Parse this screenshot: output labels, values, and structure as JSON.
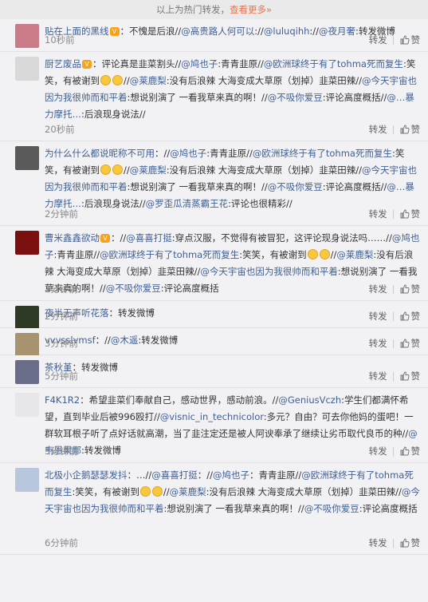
{
  "header": {
    "text": "以上为热门转发，",
    "more": "查看更多»"
  },
  "actions": {
    "repost": "转发",
    "like": "赞"
  },
  "items": [
    {
      "user": "贴在上面的黑线",
      "badge": true,
      "segments": [
        [
          "t",
          "：不愧是后浪//"
        ],
        [
          "l",
          "@高贵路人何可以"
        ],
        [
          "t",
          "://"
        ],
        [
          "l",
          "@luluqihh"
        ],
        [
          "t",
          "://"
        ],
        [
          "l",
          "@夜月奢"
        ],
        [
          "t",
          ":转发微博"
        ]
      ],
      "time": "10秒前",
      "avatar_color": "#c97b87"
    },
    {
      "user": "厨艺废品",
      "badge": true,
      "segments": [
        [
          "t",
          "：评论真是韭菜割头//"
        ],
        [
          "l",
          "@鸠也子"
        ],
        [
          "t",
          ":青青韭原//"
        ],
        [
          "l",
          "@欧洲球终于有了tohma死而复生"
        ],
        [
          "t",
          ":笑笑，有被谢到"
        ],
        [
          "e",
          ""
        ],
        [
          "e",
          ""
        ],
        [
          "t",
          "//"
        ],
        [
          "l",
          "@莱鹿梨"
        ],
        [
          "t",
          ":没有后浪辣 大海变成大草原（划掉）韭菜田辣//"
        ],
        [
          "l",
          "@今天宇宙也因为我很帅而和平着"
        ],
        [
          "t",
          ":想说别演了 一看我草来真的啊！//"
        ],
        [
          "l",
          "@不吸你爱豆"
        ],
        [
          "t",
          ":评论高度概括//"
        ],
        [
          "l",
          "@…暴力摩托…"
        ],
        [
          "t",
          ":后浪现身说法//"
        ]
      ],
      "time": "20秒前",
      "avatar_color": "#d9d9d9"
    },
    {
      "user": "为什么什么都说昵称不可用",
      "badge": false,
      "segments": [
        [
          "t",
          "：//"
        ],
        [
          "l",
          "@鸠也子"
        ],
        [
          "t",
          ":青青韭原//"
        ],
        [
          "l",
          "@欧洲球终于有了tohma死而复生"
        ],
        [
          "t",
          ":笑笑，有被谢到"
        ],
        [
          "e",
          ""
        ],
        [
          "e",
          ""
        ],
        [
          "t",
          "//"
        ],
        [
          "l",
          "@莱鹿梨"
        ],
        [
          "t",
          ":没有后浪辣 大海变成大草原（划掉）韭菜田辣//"
        ],
        [
          "l",
          "@今天宇宙也因为我很帅而和平着"
        ],
        [
          "t",
          ":想说别演了 一看我草来真的啊！//"
        ],
        [
          "l",
          "@不吸你爱豆"
        ],
        [
          "t",
          ":评论高度概括//"
        ],
        [
          "l",
          "@…暴力摩托…"
        ],
        [
          "t",
          ":后浪现身说法//"
        ],
        [
          "l",
          "@罗歪瓜清蒸霸王花"
        ],
        [
          "t",
          ":评论也很精彩//"
        ]
      ],
      "time": "2分钟前",
      "avatar_color": "#5a5a5a"
    },
    {
      "user": "曹米鑫鑫欲动",
      "badge": true,
      "segments": [
        [
          "t",
          "：//"
        ],
        [
          "l",
          "@喜喜打挺"
        ],
        [
          "t",
          ":穿点汉服，不觉得有被冒犯，这评论现身说法吗……//"
        ],
        [
          "l",
          "@鸠也子"
        ],
        [
          "t",
          ":青青韭原//"
        ],
        [
          "l",
          "@欧洲球终于有了tohma死而复生"
        ],
        [
          "t",
          ":笑笑，有被谢到"
        ],
        [
          "e",
          ""
        ],
        [
          "e",
          ""
        ],
        [
          "t",
          "//"
        ],
        [
          "l",
          "@莱鹿梨"
        ],
        [
          "t",
          ":没有后浪辣 大海变成大草原（划掉）韭菜田辣//"
        ],
        [
          "l",
          "@今天宇宙也因为我很帅而和平着"
        ],
        [
          "t",
          ":想说别演了 一看我草来真的啊！//"
        ],
        [
          "l",
          "@不吸你爱豆"
        ],
        [
          "t",
          ":评论高度概括"
        ]
      ],
      "time": "2分钟前",
      "avatar_color": "#7a1010"
    },
    {
      "user": "夜半无声听花落",
      "badge": false,
      "segments": [
        [
          "t",
          "：转发微博"
        ]
      ],
      "time": "2分钟前",
      "avatar_color": "#2e3a24"
    },
    {
      "user": "vvvsslvmsf",
      "badge": false,
      "segments": [
        [
          "t",
          "：//"
        ],
        [
          "l",
          "@木遥"
        ],
        [
          "t",
          ":转发微博"
        ]
      ],
      "time": "3分钟前",
      "avatar_color": "#a89370"
    },
    {
      "user": "茶秋堇",
      "badge": false,
      "segments": [
        [
          "t",
          "：转发微博"
        ]
      ],
      "time": "5分钟前",
      "avatar_color": "#6a6d8a"
    },
    {
      "user": "F4K1R2",
      "badge": false,
      "segments": [
        [
          "t",
          "：希望韭菜们奉献自己，感动世界，感动前浪。//"
        ],
        [
          "l",
          "@GeniusVczh"
        ],
        [
          "t",
          ":学生们都满怀希望，直到毕业后被996殴打//"
        ],
        [
          "l",
          "@visnic_in_technicolor"
        ],
        [
          "t",
          ":多元？自由？可去你他妈的蛋吧！一群软耳根子听了点好话就高潮，当了韭注定还是被人阿谀奉承了继续让劣币取代良币的种//"
        ],
        [
          "l",
          "@韦恩果鄙"
        ],
        [
          "t",
          ":转发微博"
        ]
      ],
      "time": "5分钟前",
      "avatar_color": "#e7e7ea"
    },
    {
      "user": "北极小企鹅瑟瑟发抖",
      "badge": false,
      "segments": [
        [
          "t",
          "：…//"
        ],
        [
          "l",
          "@喜喜打挺"
        ],
        [
          "t",
          "：//"
        ],
        [
          "l",
          "@鸠也子"
        ],
        [
          "t",
          "：青青韭原//"
        ],
        [
          "l",
          "@欧洲球终于有了tohma死而复生"
        ],
        [
          "t",
          ":笑笑，有被谢到"
        ],
        [
          "e",
          ""
        ],
        [
          "e",
          ""
        ],
        [
          "t",
          "//"
        ],
        [
          "l",
          "@莱鹿梨"
        ],
        [
          "t",
          ":没有后浪辣 大海变成大草原（划掉）韭菜田辣//"
        ],
        [
          "l",
          "@今天宇宙也因为我很帅而和平着"
        ],
        [
          "t",
          ":想说别演了 一看我草来真的啊！//"
        ],
        [
          "l",
          "@不吸你爱豆"
        ],
        [
          "t",
          ":评论高度概括"
        ]
      ],
      "time": "6分钟前",
      "avatar_color": "#b9c7de"
    }
  ]
}
